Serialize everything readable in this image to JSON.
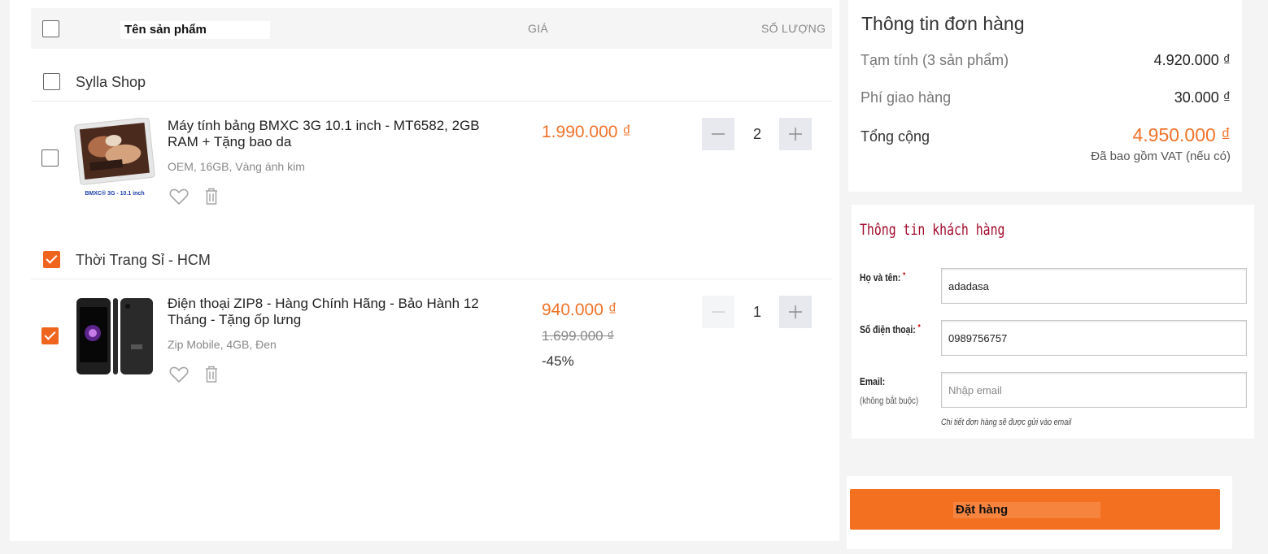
{
  "colors": {
    "accent": "#f0732b",
    "button": "#f37021",
    "customer_title": "#a30a2a"
  },
  "cart_header": {
    "product_col": "Tên sản phẩm",
    "price_col": "GIÁ",
    "qty_col": "SỐ LƯỢNG"
  },
  "shops": [
    {
      "name": "Sylla Shop",
      "checked": false,
      "items": [
        {
          "name": "Máy tính bảng BMXC 3G 10.1 inch - MT6582, 2GB RAM + Tặng bao da",
          "attributes": "OEM, 16GB, Vàng ánh kim",
          "image_caption": "BMXC® 3G - 10.1 inch",
          "price": "1.990.000 ₫",
          "quantity": "2",
          "checked": false,
          "icons": [
            "heart-icon",
            "trash-icon",
            "minus-icon",
            "plus-icon"
          ]
        }
      ]
    },
    {
      "name": "Thời Trang Sỉ - HCM",
      "checked": true,
      "items": [
        {
          "name": "Điện thoại ZIP8 - Hàng Chính Hãng - Bảo Hành 12 Tháng - Tặng ốp lưng",
          "attributes": "Zip Mobile, 4GB, Đen",
          "price": "940.000 ₫",
          "old_price": "1.699.000 ₫",
          "discount": "-45%",
          "quantity": "1",
          "checked": true,
          "icons": [
            "heart-icon",
            "trash-icon",
            "minus-icon",
            "plus-icon"
          ]
        }
      ]
    }
  ],
  "summary": {
    "title": "Thông tin đơn hàng",
    "subtotal_label": "Tạm tính (3 sản phẩm)",
    "subtotal_value": "4.920.000 ₫",
    "shipping_label": "Phí giao hàng",
    "shipping_value": "30.000 ₫",
    "total_label": "Tổng cộng",
    "total_value": "4.950.000 ₫",
    "vat_note": "Đã bao gồm VAT (nếu có)"
  },
  "customer": {
    "title": "Thông tin khách hàng",
    "name_label": "Họ và tên:",
    "name_value": "adadasa",
    "phone_label": "Số điện thoại:",
    "phone_value": "0989756757",
    "email_label": "Email:",
    "email_sublabel": "(không bắt buộc)",
    "email_placeholder": "Nhập email",
    "required_mark": "*",
    "email_note": "Chi tiết đơn hàng sẽ được gửi vào email"
  },
  "order_button": {
    "label": "Đặt hàng"
  }
}
